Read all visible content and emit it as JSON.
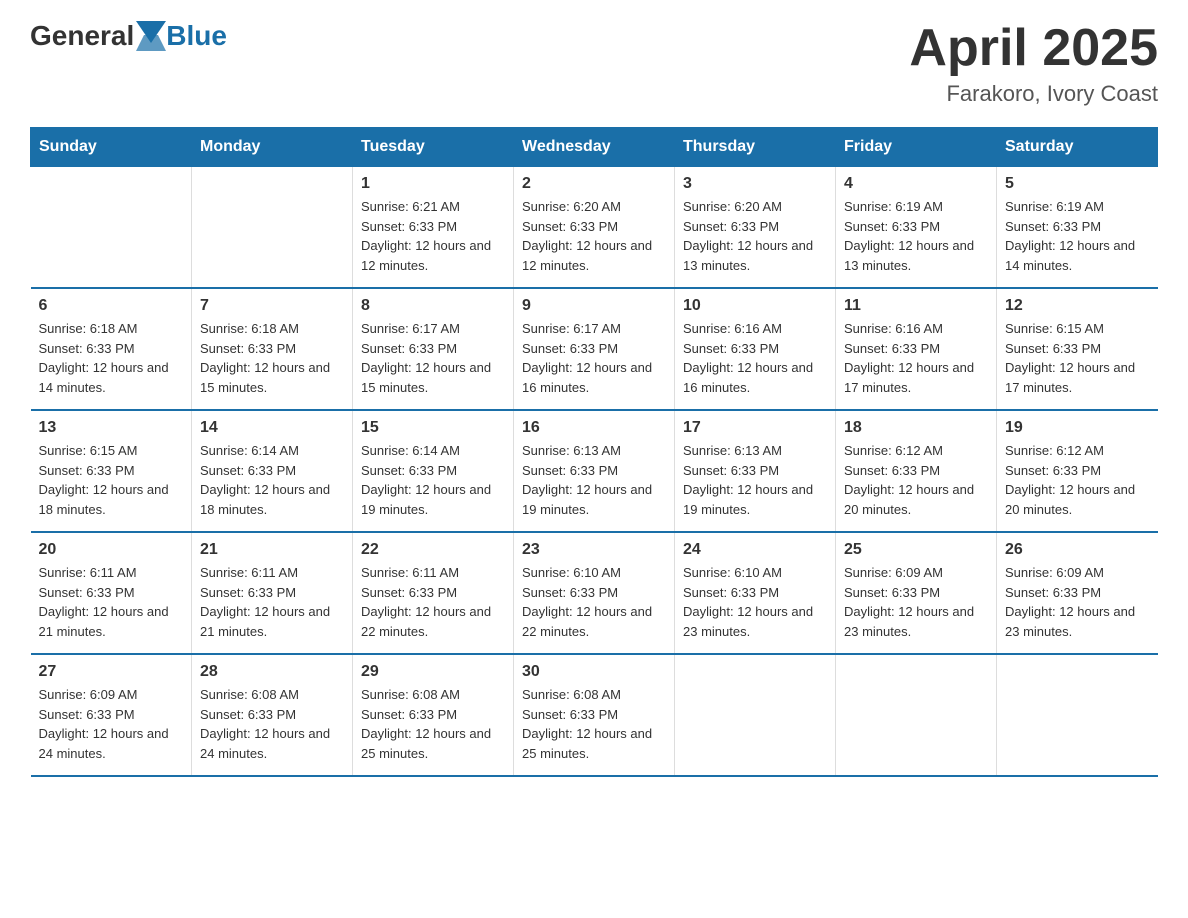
{
  "logo": {
    "general": "General",
    "blue": "Blue"
  },
  "title": "April 2025",
  "subtitle": "Farakoro, Ivory Coast",
  "headers": [
    "Sunday",
    "Monday",
    "Tuesday",
    "Wednesday",
    "Thursday",
    "Friday",
    "Saturday"
  ],
  "weeks": [
    [
      {
        "day": "",
        "sunrise": "",
        "sunset": "",
        "daylight": ""
      },
      {
        "day": "",
        "sunrise": "",
        "sunset": "",
        "daylight": ""
      },
      {
        "day": "1",
        "sunrise": "Sunrise: 6:21 AM",
        "sunset": "Sunset: 6:33 PM",
        "daylight": "Daylight: 12 hours and 12 minutes."
      },
      {
        "day": "2",
        "sunrise": "Sunrise: 6:20 AM",
        "sunset": "Sunset: 6:33 PM",
        "daylight": "Daylight: 12 hours and 12 minutes."
      },
      {
        "day": "3",
        "sunrise": "Sunrise: 6:20 AM",
        "sunset": "Sunset: 6:33 PM",
        "daylight": "Daylight: 12 hours and 13 minutes."
      },
      {
        "day": "4",
        "sunrise": "Sunrise: 6:19 AM",
        "sunset": "Sunset: 6:33 PM",
        "daylight": "Daylight: 12 hours and 13 minutes."
      },
      {
        "day": "5",
        "sunrise": "Sunrise: 6:19 AM",
        "sunset": "Sunset: 6:33 PM",
        "daylight": "Daylight: 12 hours and 14 minutes."
      }
    ],
    [
      {
        "day": "6",
        "sunrise": "Sunrise: 6:18 AM",
        "sunset": "Sunset: 6:33 PM",
        "daylight": "Daylight: 12 hours and 14 minutes."
      },
      {
        "day": "7",
        "sunrise": "Sunrise: 6:18 AM",
        "sunset": "Sunset: 6:33 PM",
        "daylight": "Daylight: 12 hours and 15 minutes."
      },
      {
        "day": "8",
        "sunrise": "Sunrise: 6:17 AM",
        "sunset": "Sunset: 6:33 PM",
        "daylight": "Daylight: 12 hours and 15 minutes."
      },
      {
        "day": "9",
        "sunrise": "Sunrise: 6:17 AM",
        "sunset": "Sunset: 6:33 PM",
        "daylight": "Daylight: 12 hours and 16 minutes."
      },
      {
        "day": "10",
        "sunrise": "Sunrise: 6:16 AM",
        "sunset": "Sunset: 6:33 PM",
        "daylight": "Daylight: 12 hours and 16 minutes."
      },
      {
        "day": "11",
        "sunrise": "Sunrise: 6:16 AM",
        "sunset": "Sunset: 6:33 PM",
        "daylight": "Daylight: 12 hours and 17 minutes."
      },
      {
        "day": "12",
        "sunrise": "Sunrise: 6:15 AM",
        "sunset": "Sunset: 6:33 PM",
        "daylight": "Daylight: 12 hours and 17 minutes."
      }
    ],
    [
      {
        "day": "13",
        "sunrise": "Sunrise: 6:15 AM",
        "sunset": "Sunset: 6:33 PM",
        "daylight": "Daylight: 12 hours and 18 minutes."
      },
      {
        "day": "14",
        "sunrise": "Sunrise: 6:14 AM",
        "sunset": "Sunset: 6:33 PM",
        "daylight": "Daylight: 12 hours and 18 minutes."
      },
      {
        "day": "15",
        "sunrise": "Sunrise: 6:14 AM",
        "sunset": "Sunset: 6:33 PM",
        "daylight": "Daylight: 12 hours and 19 minutes."
      },
      {
        "day": "16",
        "sunrise": "Sunrise: 6:13 AM",
        "sunset": "Sunset: 6:33 PM",
        "daylight": "Daylight: 12 hours and 19 minutes."
      },
      {
        "day": "17",
        "sunrise": "Sunrise: 6:13 AM",
        "sunset": "Sunset: 6:33 PM",
        "daylight": "Daylight: 12 hours and 19 minutes."
      },
      {
        "day": "18",
        "sunrise": "Sunrise: 6:12 AM",
        "sunset": "Sunset: 6:33 PM",
        "daylight": "Daylight: 12 hours and 20 minutes."
      },
      {
        "day": "19",
        "sunrise": "Sunrise: 6:12 AM",
        "sunset": "Sunset: 6:33 PM",
        "daylight": "Daylight: 12 hours and 20 minutes."
      }
    ],
    [
      {
        "day": "20",
        "sunrise": "Sunrise: 6:11 AM",
        "sunset": "Sunset: 6:33 PM",
        "daylight": "Daylight: 12 hours and 21 minutes."
      },
      {
        "day": "21",
        "sunrise": "Sunrise: 6:11 AM",
        "sunset": "Sunset: 6:33 PM",
        "daylight": "Daylight: 12 hours and 21 minutes."
      },
      {
        "day": "22",
        "sunrise": "Sunrise: 6:11 AM",
        "sunset": "Sunset: 6:33 PM",
        "daylight": "Daylight: 12 hours and 22 minutes."
      },
      {
        "day": "23",
        "sunrise": "Sunrise: 6:10 AM",
        "sunset": "Sunset: 6:33 PM",
        "daylight": "Daylight: 12 hours and 22 minutes."
      },
      {
        "day": "24",
        "sunrise": "Sunrise: 6:10 AM",
        "sunset": "Sunset: 6:33 PM",
        "daylight": "Daylight: 12 hours and 23 minutes."
      },
      {
        "day": "25",
        "sunrise": "Sunrise: 6:09 AM",
        "sunset": "Sunset: 6:33 PM",
        "daylight": "Daylight: 12 hours and 23 minutes."
      },
      {
        "day": "26",
        "sunrise": "Sunrise: 6:09 AM",
        "sunset": "Sunset: 6:33 PM",
        "daylight": "Daylight: 12 hours and 23 minutes."
      }
    ],
    [
      {
        "day": "27",
        "sunrise": "Sunrise: 6:09 AM",
        "sunset": "Sunset: 6:33 PM",
        "daylight": "Daylight: 12 hours and 24 minutes."
      },
      {
        "day": "28",
        "sunrise": "Sunrise: 6:08 AM",
        "sunset": "Sunset: 6:33 PM",
        "daylight": "Daylight: 12 hours and 24 minutes."
      },
      {
        "day": "29",
        "sunrise": "Sunrise: 6:08 AM",
        "sunset": "Sunset: 6:33 PM",
        "daylight": "Daylight: 12 hours and 25 minutes."
      },
      {
        "day": "30",
        "sunrise": "Sunrise: 6:08 AM",
        "sunset": "Sunset: 6:33 PM",
        "daylight": "Daylight: 12 hours and 25 minutes."
      },
      {
        "day": "",
        "sunrise": "",
        "sunset": "",
        "daylight": ""
      },
      {
        "day": "",
        "sunrise": "",
        "sunset": "",
        "daylight": ""
      },
      {
        "day": "",
        "sunrise": "",
        "sunset": "",
        "daylight": ""
      }
    ]
  ]
}
